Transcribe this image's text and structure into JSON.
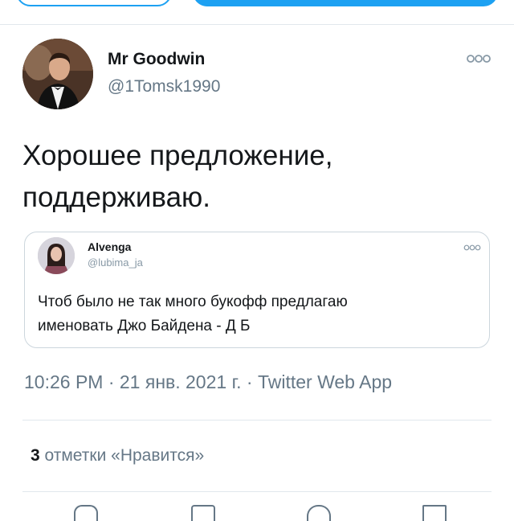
{
  "author": {
    "name": "Mr Goodwin",
    "handle": "@1Tomsk1990"
  },
  "tweet": {
    "text": "Хорошее предложение,\nподдерживаю."
  },
  "quoted": {
    "name": "Alvenga",
    "handle": "@lubima_ja",
    "text": "Чтоб было не так много букофф предлагаю\nименовать Джо Байдена - Д Б"
  },
  "meta": {
    "text": "10:26 PM · 21 янв. 2021 г. · Twitter Web App"
  },
  "likes": {
    "count": "3",
    "label": "отметки «Нравится»"
  },
  "icons": {
    "more": "more-dots-icon",
    "reply": "reply-icon",
    "retweet": "retweet-icon",
    "like": "like-icon"
  },
  "colors": {
    "accent": "#1da1f2",
    "secondary_text": "#657786"
  }
}
